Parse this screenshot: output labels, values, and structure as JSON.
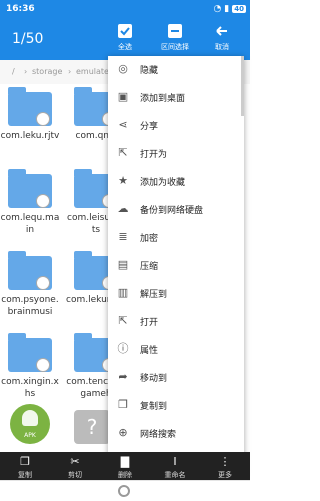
{
  "status": {
    "time": "16:36",
    "battery": "40"
  },
  "appbar": {
    "count": "1/50",
    "select_all": "全选",
    "range_select": "区间选择",
    "cancel": "取消"
  },
  "breadcrumb": {
    "sep1": "/",
    "storage": "storage",
    "emulated": "emulated"
  },
  "files": [
    {
      "name": "com.leku.rjtv"
    },
    {
      "name": "com.qncl"
    },
    {
      "name": "com.lequ.main"
    },
    {
      "name": "com.leisuports"
    },
    {
      "name": "com.psyone.brainmusi"
    },
    {
      "name": "com.lekumsq"
    },
    {
      "name": "com.xingin.xhs"
    },
    {
      "name": "com.tencent.gameh"
    }
  ],
  "apk_label": "APK",
  "menu": [
    {
      "label": "隐藏",
      "icon": "eye-off-icon"
    },
    {
      "label": "添加到桌面",
      "icon": "add-to-desktop-icon"
    },
    {
      "label": "分享",
      "icon": "share-icon"
    },
    {
      "label": "打开为",
      "icon": "open-as-icon"
    },
    {
      "label": "添加为收藏",
      "icon": "star-icon"
    },
    {
      "label": "备份到网络硬盘",
      "icon": "cloud-upload-icon"
    },
    {
      "label": "加密",
      "icon": "encrypt-icon"
    },
    {
      "label": "压缩",
      "icon": "compress-icon"
    },
    {
      "label": "解压到",
      "icon": "extract-icon"
    },
    {
      "label": "打开",
      "icon": "open-icon"
    },
    {
      "label": "属性",
      "icon": "info-icon"
    },
    {
      "label": "移动到",
      "icon": "move-icon"
    },
    {
      "label": "复制到",
      "icon": "copy-to-icon"
    },
    {
      "label": "网络搜索",
      "icon": "web-search-icon"
    }
  ],
  "bottombar": {
    "copy": "复制",
    "cut": "剪切",
    "delete": "删除",
    "rename": "重命名",
    "more": "更多"
  }
}
